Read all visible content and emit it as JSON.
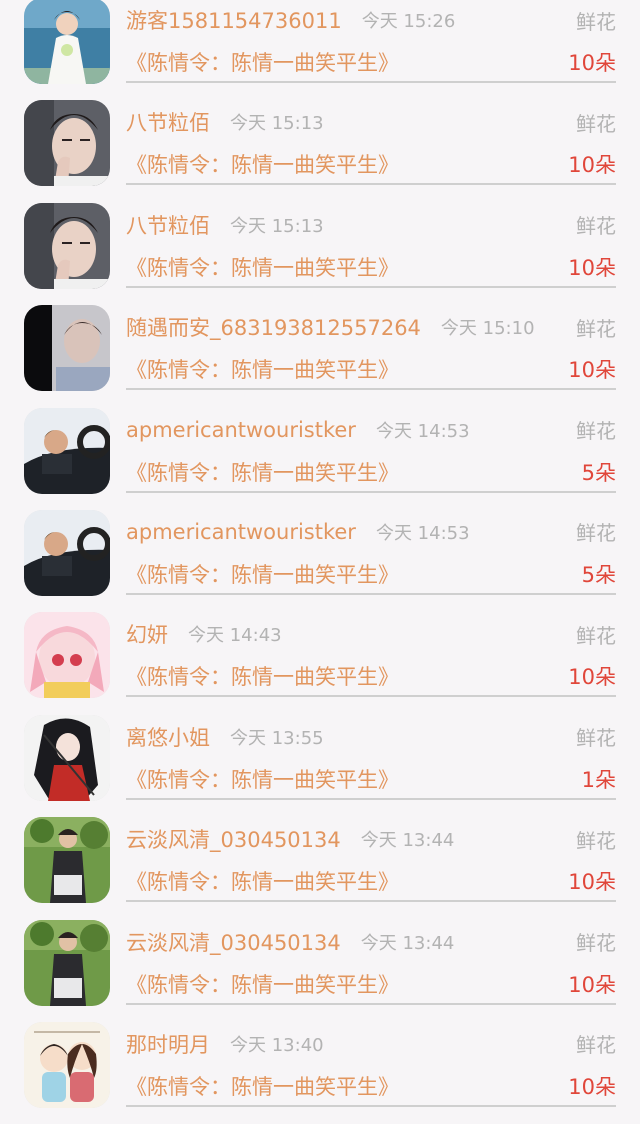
{
  "items": [
    {
      "username": "游客1581154736011",
      "time": "今天 15:26",
      "gift": "鲜花",
      "title": "《陈情令：陈情一曲笑平生》",
      "qty": "10朵",
      "avatar": "bride-photo"
    },
    {
      "username": "八节粒佰",
      "time": "今天 15:13",
      "gift": "鲜花",
      "title": "《陈情令：陈情一曲笑平生》",
      "qty": "10朵",
      "avatar": "man-portrait"
    },
    {
      "username": "八节粒佰",
      "time": "今天 15:13",
      "gift": "鲜花",
      "title": "《陈情令：陈情一曲笑平生》",
      "qty": "10朵",
      "avatar": "man-portrait"
    },
    {
      "username": "随遇而安_683193812557264",
      "time": "今天 15:10",
      "gift": "鲜花",
      "title": "《陈情令：陈情一曲笑平生》",
      "qty": "10朵",
      "avatar": "girl-photo"
    },
    {
      "username": "apmericantwouristker",
      "time": "今天 14:53",
      "gift": "鲜花",
      "title": "《陈情令：陈情一曲笑平生》",
      "qty": "5朵",
      "avatar": "car-driver"
    },
    {
      "username": "apmericantwouristker",
      "time": "今天 14:53",
      "gift": "鲜花",
      "title": "《陈情令：陈情一曲笑平生》",
      "qty": "5朵",
      "avatar": "car-driver"
    },
    {
      "username": "幻妍",
      "time": "今天 14:43",
      "gift": "鲜花",
      "title": "《陈情令：陈情一曲笑平生》",
      "qty": "10朵",
      "avatar": "anime-pink"
    },
    {
      "username": "离悠小姐",
      "time": "今天 13:55",
      "gift": "鲜花",
      "title": "《陈情令：陈情一曲笑平生》",
      "qty": "1朵",
      "avatar": "anime-dark"
    },
    {
      "username": "云淡风清_030450134",
      "time": "今天 13:44",
      "gift": "鲜花",
      "title": "《陈情令：陈情一曲笑平生》",
      "qty": "10朵",
      "avatar": "garden-photo"
    },
    {
      "username": "云淡风清_030450134",
      "time": "今天 13:44",
      "gift": "鲜花",
      "title": "《陈情令：陈情一曲笑平生》",
      "qty": "10朵",
      "avatar": "garden-photo"
    },
    {
      "username": "那时明月",
      "time": "今天 13:40",
      "gift": "鲜花",
      "title": "《陈情令：陈情一曲笑平生》",
      "qty": "10朵",
      "avatar": "chibi-couple"
    }
  ],
  "colors": {
    "username": "#e2965f",
    "title": "#e2965f",
    "quantity": "#e0463a",
    "muted": "#b3b3b3",
    "divider": "#cfcfcf",
    "background": "#f7f5f7"
  }
}
